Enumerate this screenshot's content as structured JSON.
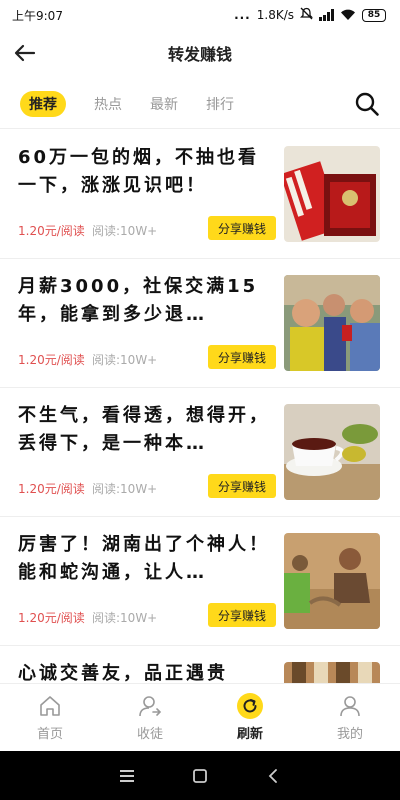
{
  "status_bar": {
    "time": "上午9:07",
    "dots": "...",
    "speed": "1.8K/s",
    "battery": "85"
  },
  "header": {
    "title": "转发赚钱",
    "back_icon": "arrow-left-icon"
  },
  "tabs": [
    {
      "label": "推荐",
      "active": true
    },
    {
      "label": "热点",
      "active": false
    },
    {
      "label": "最新",
      "active": false
    },
    {
      "label": "排行",
      "active": false
    }
  ],
  "articles": [
    {
      "title": "60万一包的烟，不抽也看一下，涨涨见识吧！",
      "price": "1.20元/阅读",
      "reads": "阅读:10W+",
      "share_label": "分享赚钱",
      "thumb": "cigarette-pack"
    },
    {
      "title": "月薪3000，社保交满15年，能拿到多少退…",
      "price": "1.20元/阅读",
      "reads": "阅读:10W+",
      "share_label": "分享赚钱",
      "thumb": "elderly-people"
    },
    {
      "title": "不生气，看得透，想得开，丢得下，是一种本…",
      "price": "1.20元/阅读",
      "reads": "阅读:10W+",
      "share_label": "分享赚钱",
      "thumb": "tea-cup"
    },
    {
      "title": "厉害了！湖南出了个神人！能和蛇沟通，让人…",
      "price": "1.20元/阅读",
      "reads": "阅读:10W+",
      "share_label": "分享赚钱",
      "thumb": "man-outdoors"
    },
    {
      "title": "心诚交善友，品正遇贵",
      "price": "",
      "reads": "",
      "share_label": "",
      "thumb": "building"
    }
  ],
  "bottom_nav": [
    {
      "label": "首页",
      "icon": "home-icon",
      "active": false
    },
    {
      "label": "收徒",
      "icon": "user-add-icon",
      "active": false
    },
    {
      "label": "刷新",
      "icon": "refresh-icon",
      "active": true
    },
    {
      "label": "我的",
      "icon": "profile-icon",
      "active": false
    }
  ],
  "colors": {
    "accent": "#ffd91a",
    "price": "#e05050",
    "muted": "#999999"
  }
}
